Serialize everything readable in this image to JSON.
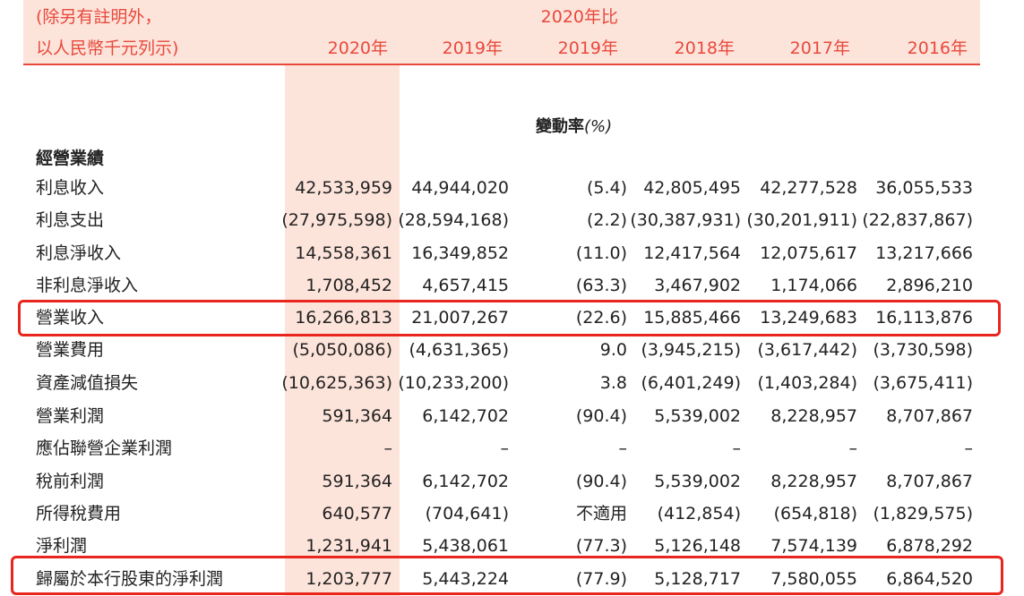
{
  "header": {
    "unit_line1": "(除另有註明外，",
    "unit_line2": "以人民幣千元列示)",
    "col_2020": "2020年",
    "col_2019": "2019年",
    "change_line1": "2020年比",
    "change_line2": "2019年",
    "col_2018": "2018年",
    "col_2017": "2017年",
    "col_2016": "2016年"
  },
  "change_unit": "變動率",
  "change_unit_pct": "(%)",
  "section_title": "經營業績",
  "rows": [
    {
      "label": "利息收入",
      "v2020": "42,533,959",
      "v2019": "44,944,020",
      "chg": "(5.4)",
      "v2018": "42,805,495",
      "v2017": "42,277,528",
      "v2016": "36,055,533"
    },
    {
      "label": "利息支出",
      "v2020": "(27,975,598)",
      "v2019": "(28,594,168)",
      "chg": "(2.2)",
      "v2018": "(30,387,931)",
      "v2017": "(30,201,911)",
      "v2016": "(22,837,867)"
    },
    {
      "label": "利息淨收入",
      "v2020": "14,558,361",
      "v2019": "16,349,852",
      "chg": "(11.0)",
      "v2018": "12,417,564",
      "v2017": "12,075,617",
      "v2016": "13,217,666"
    },
    {
      "label": "非利息淨收入",
      "v2020": "1,708,452",
      "v2019": "4,657,415",
      "chg": "(63.3)",
      "v2018": "3,467,902",
      "v2017": "1,174,066",
      "v2016": "2,896,210"
    },
    {
      "label": "營業收入",
      "v2020": "16,266,813",
      "v2019": "21,007,267",
      "chg": "(22.6)",
      "v2018": "15,885,466",
      "v2017": "13,249,683",
      "v2016": "16,113,876"
    },
    {
      "label": "營業費用",
      "v2020": "(5,050,086)",
      "v2019": "(4,631,365)",
      "chg": "9.0",
      "v2018": "(3,945,215)",
      "v2017": "(3,617,442)",
      "v2016": "(3,730,598)"
    },
    {
      "label": "資產減值損失",
      "v2020": "(10,625,363)",
      "v2019": "(10,233,200)",
      "chg": "3.8",
      "v2018": "(6,401,249)",
      "v2017": "(1,403,284)",
      "v2016": "(3,675,411)"
    },
    {
      "label": "營業利潤",
      "v2020": "591,364",
      "v2019": "6,142,702",
      "chg": "(90.4)",
      "v2018": "5,539,002",
      "v2017": "8,228,957",
      "v2016": "8,707,867"
    },
    {
      "label": "應佔聯營企業利潤",
      "v2020": "–",
      "v2019": "–",
      "chg": "–",
      "v2018": "–",
      "v2017": "–",
      "v2016": "–"
    },
    {
      "label": "稅前利潤",
      "v2020": "591,364",
      "v2019": "6,142,702",
      "chg": "(90.4)",
      "v2018": "5,539,002",
      "v2017": "8,228,957",
      "v2016": "8,707,867"
    },
    {
      "label": "所得稅費用",
      "v2020": "640,577",
      "v2019": "(704,641)",
      "chg": "不適用",
      "v2018": "(412,854)",
      "v2017": "(654,818)",
      "v2016": "(1,829,575)"
    },
    {
      "label": "淨利潤",
      "v2020": "1,231,941",
      "v2019": "5,438,061",
      "chg": "(77.3)",
      "v2018": "5,126,148",
      "v2017": "7,574,139",
      "v2016": "6,878,292"
    },
    {
      "label": "歸屬於本行股東的淨利潤",
      "v2020": "1,203,777",
      "v2019": "5,443,224",
      "chg": "(77.9)",
      "v2018": "5,128,717",
      "v2017": "7,580,055",
      "v2016": "6,864,520"
    }
  ]
}
